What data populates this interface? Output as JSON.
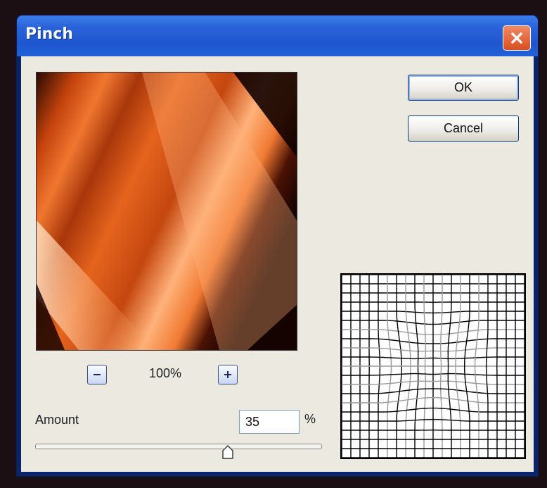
{
  "window": {
    "title": "Pinch"
  },
  "buttons": {
    "ok": "OK",
    "cancel": "Cancel"
  },
  "zoom": {
    "value": "100%"
  },
  "amount": {
    "label": "Amount",
    "value": "35",
    "unit": "%",
    "min": -100,
    "max": 100
  },
  "icons": {
    "close": "close-icon",
    "zoom_out": "minus-icon",
    "zoom_in": "plus-icon"
  },
  "colors": {
    "titlebar": "#2a63d9",
    "dialog_bg": "#ece9e1",
    "close_button": "#d94d20",
    "preview_glow": "#ff8a3a"
  }
}
